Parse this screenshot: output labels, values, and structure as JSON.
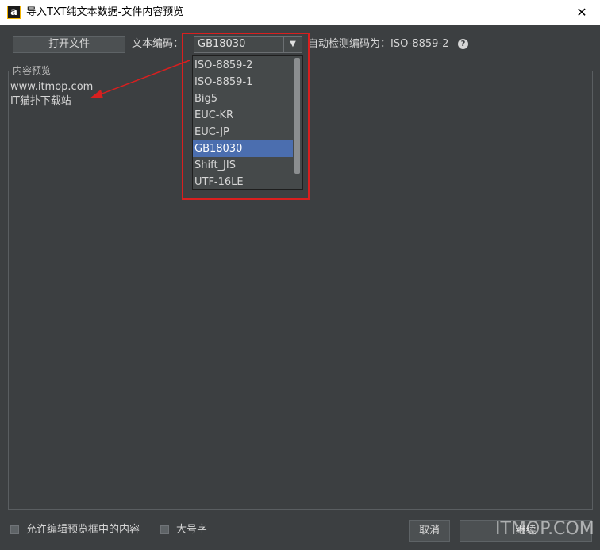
{
  "window": {
    "app_icon": "a",
    "title": "导入TXT纯文本数据-文件内容预览",
    "close_glyph": "✕"
  },
  "toolbar": {
    "open_file_label": "打开文件",
    "encoding_label": "文本编码：",
    "encoding_selected": "GB18030",
    "detected_text": "自动检测编码为：ISO-8859-2",
    "help_glyph": "?"
  },
  "encoding_options": [
    {
      "label": "ISO-8859-2",
      "selected": false
    },
    {
      "label": "ISO-8859-1",
      "selected": false
    },
    {
      "label": "Big5",
      "selected": false
    },
    {
      "label": "EUC-KR",
      "selected": false
    },
    {
      "label": "EUC-JP",
      "selected": false
    },
    {
      "label": "GB18030",
      "selected": true
    },
    {
      "label": "Shift_JIS",
      "selected": false
    },
    {
      "label": "UTF-16LE",
      "selected": false
    }
  ],
  "preview": {
    "legend": "内容预览",
    "lines": [
      "www.itmop.com",
      "IT猫扑下载站"
    ]
  },
  "footer": {
    "allow_edit_label": "允许编辑预览框中的内容",
    "large_font_label": "大号字",
    "cancel_label": "取消",
    "continue_label": "继续"
  },
  "watermark": "ITMOP.COM",
  "colors": {
    "background": "#3c3f41",
    "selection": "#4b6eaf",
    "annotation": "#d91f1f"
  }
}
